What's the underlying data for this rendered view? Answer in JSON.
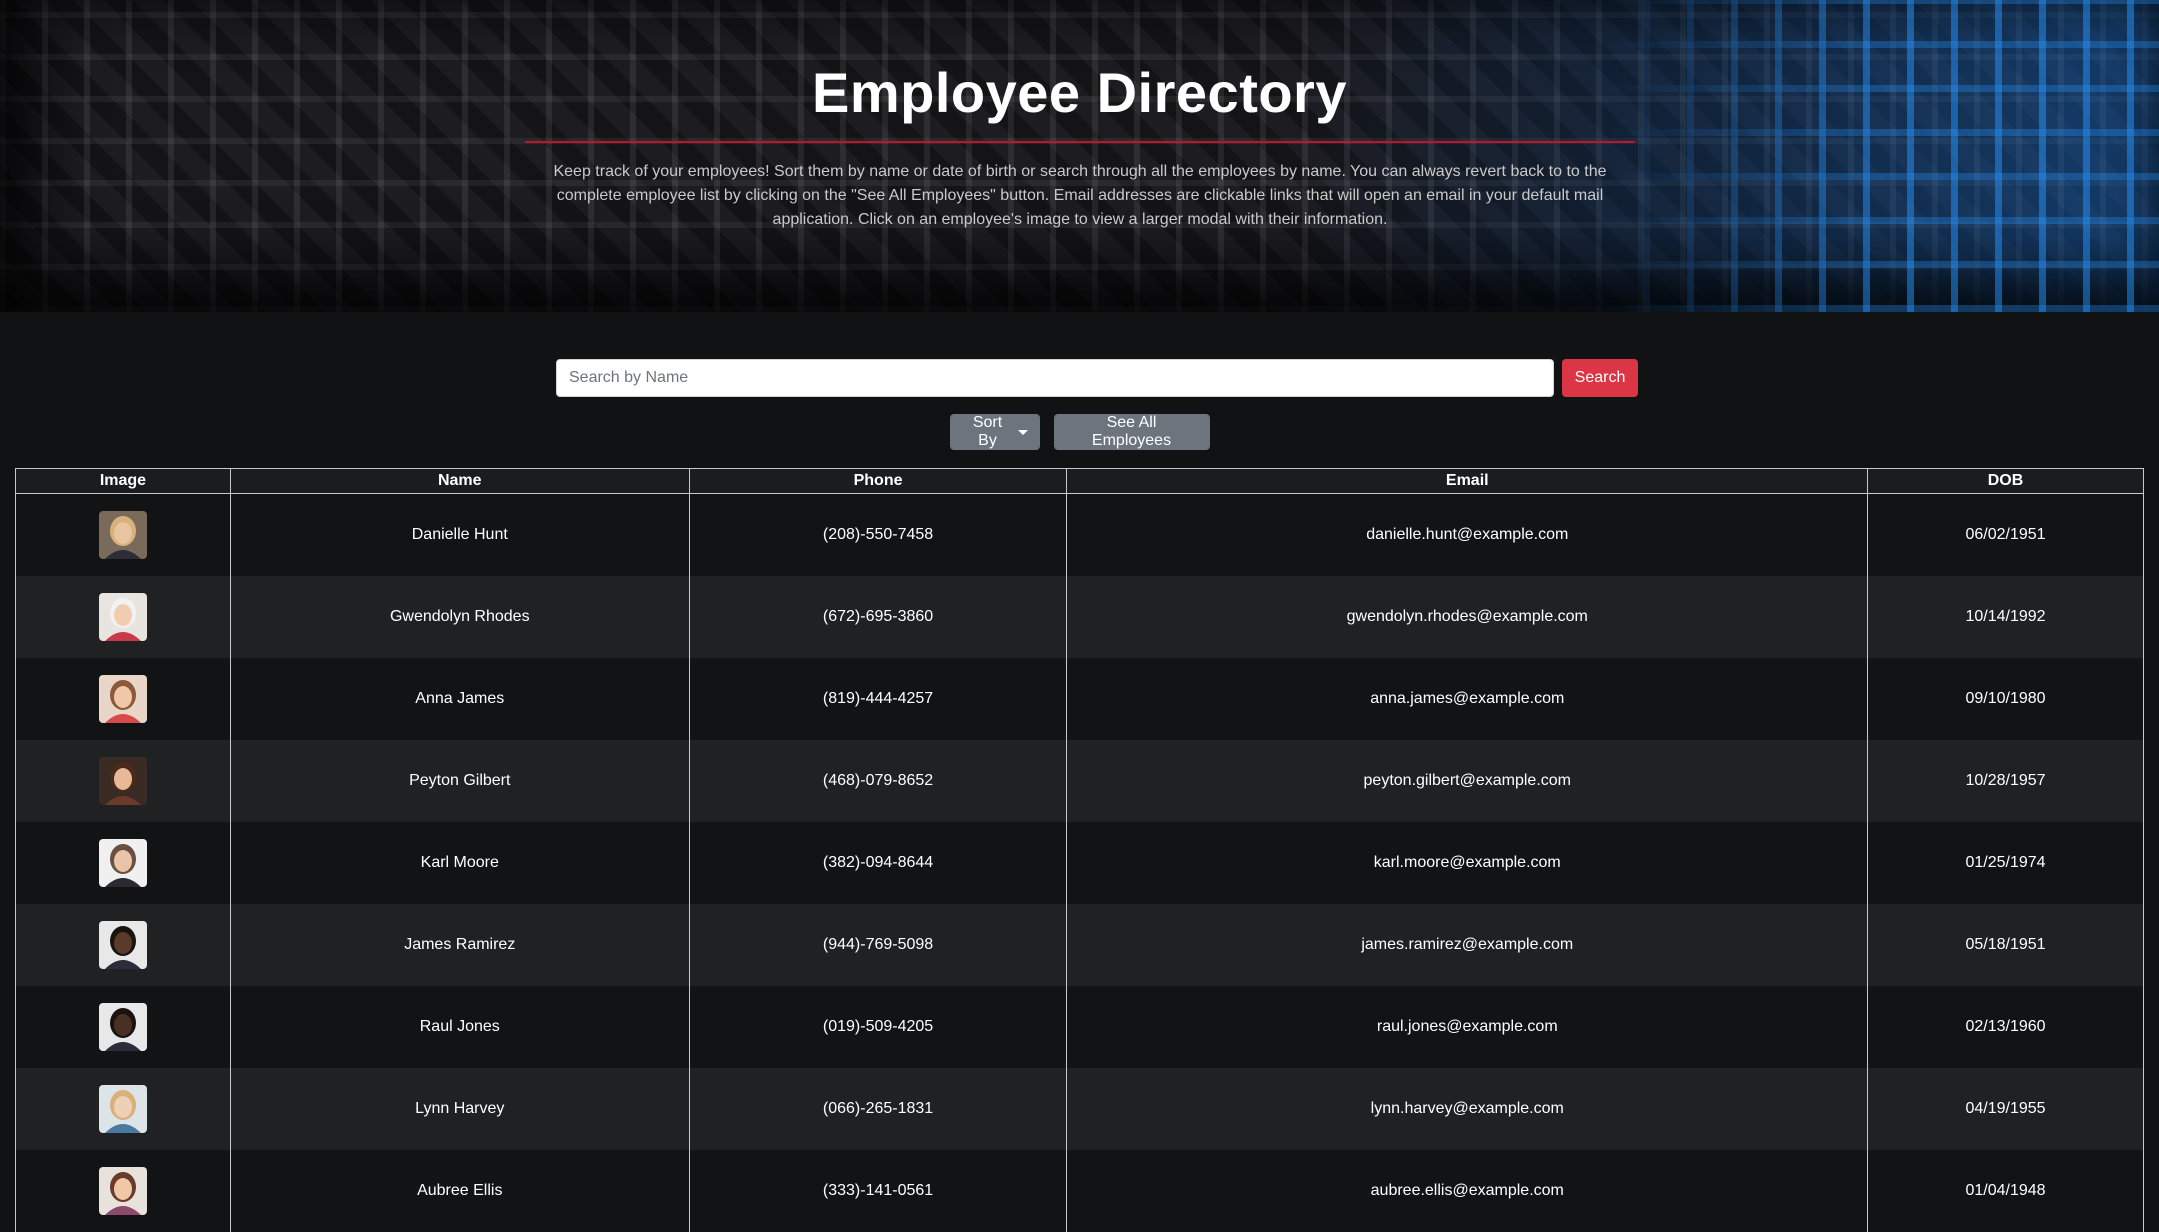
{
  "header": {
    "title": "Employee Directory",
    "description": "Keep track of your employees! Sort them by name or date of birth or search through all the employees by name. You can always revert back to to the complete employee list by clicking on the \"See All Employees\" button. Email addresses are clickable links that will open an email in your default mail application. Click on an employee's image to view a larger modal with their information."
  },
  "search": {
    "placeholder": "Search by Name",
    "value": "",
    "button_label": "Search"
  },
  "controls": {
    "sort_label": "Sort By",
    "see_all_label": "See All Employees"
  },
  "table": {
    "columns": [
      "Image",
      "Name",
      "Phone",
      "Email",
      "DOB"
    ],
    "rows": [
      {
        "name": "Danielle Hunt",
        "phone": "(208)-550-7458",
        "email": "danielle.hunt@example.com",
        "dob": "06/02/1951",
        "avatar": {
          "bg": "#7a6a5a",
          "skin": "#e8c4a0",
          "hair": "#d8b27a",
          "shirt": "#2d2d3a"
        }
      },
      {
        "name": "Gwendolyn Rhodes",
        "phone": "(672)-695-3860",
        "email": "gwendolyn.rhodes@example.com",
        "dob": "10/14/1992",
        "avatar": {
          "bg": "#e8e4e0",
          "skin": "#f0cdb0",
          "hair": "#f2f2f2",
          "shirt": "#c83a4a"
        }
      },
      {
        "name": "Anna James",
        "phone": "(819)-444-4257",
        "email": "anna.james@example.com",
        "dob": "09/10/1980",
        "avatar": {
          "bg": "#e9d6c8",
          "skin": "#f0c8a8",
          "hair": "#8a5a3a",
          "shirt": "#d84a4a"
        }
      },
      {
        "name": "Peyton Gilbert",
        "phone": "(468)-079-8652",
        "email": "peyton.gilbert@example.com",
        "dob": "10/28/1957",
        "avatar": {
          "bg": "#3a2a24",
          "skin": "#e8b898",
          "hair": "#4a2a1a",
          "shirt": "#6a3a2a"
        }
      },
      {
        "name": "Karl Moore",
        "phone": "(382)-094-8644",
        "email": "karl.moore@example.com",
        "dob": "01/25/1974",
        "avatar": {
          "bg": "#f0f0f0",
          "skin": "#e8c4a8",
          "hair": "#6a5040",
          "shirt": "#2a2a30"
        }
      },
      {
        "name": "James Ramirez",
        "phone": "(944)-769-5098",
        "email": "james.ramirez@example.com",
        "dob": "05/18/1951",
        "avatar": {
          "bg": "#e8e8e8",
          "skin": "#5a3a2a",
          "hair": "#1a1410",
          "shirt": "#2a2e3a"
        }
      },
      {
        "name": "Raul Jones",
        "phone": "(019)-509-4205",
        "email": "raul.jones@example.com",
        "dob": "02/13/1960",
        "avatar": {
          "bg": "#e8e8e8",
          "skin": "#4a3022",
          "hair": "#1a1410",
          "shirt": "#2a2e3a"
        }
      },
      {
        "name": "Lynn Harvey",
        "phone": "(066)-265-1831",
        "email": "lynn.harvey@example.com",
        "dob": "04/19/1955",
        "avatar": {
          "bg": "#dde4e8",
          "skin": "#f0d0b4",
          "hair": "#d8b07a",
          "shirt": "#4a7aa0"
        }
      },
      {
        "name": "Aubree Ellis",
        "phone": "(333)-141-0561",
        "email": "aubree.ellis@example.com",
        "dob": "01/04/1948",
        "avatar": {
          "bg": "#e8e2dc",
          "skin": "#f0c8a8",
          "hair": "#6a3a2a",
          "shirt": "#8a4a6a"
        }
      }
    ]
  }
}
